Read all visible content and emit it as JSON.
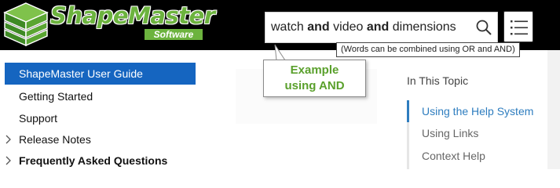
{
  "header": {
    "logo": {
      "title": "ShapeMaster",
      "subtitle": "Software"
    },
    "search": {
      "value_parts": [
        {
          "text": "watch ",
          "bold": false
        },
        {
          "text": "and",
          "bold": true
        },
        {
          "text": " video ",
          "bold": false
        },
        {
          "text": "and",
          "bold": true
        },
        {
          "text": " dimensions",
          "bold": false
        }
      ]
    }
  },
  "tooltip": {
    "text": "(Words can be combined using OR and AND)"
  },
  "callout": {
    "line1": "Example",
    "line2": "using AND"
  },
  "sidebar": {
    "items": [
      {
        "label": "ShapeMaster User Guide",
        "active": true,
        "expandable": false,
        "bold": false
      },
      {
        "label": "Getting Started",
        "active": false,
        "expandable": false,
        "bold": false
      },
      {
        "label": "Support",
        "active": false,
        "expandable": false,
        "bold": false
      },
      {
        "label": "Release Notes",
        "active": false,
        "expandable": true,
        "bold": false
      },
      {
        "label": "Frequently Asked Questions",
        "active": false,
        "expandable": true,
        "bold": true
      }
    ]
  },
  "topic": {
    "heading": "In This Topic",
    "links": [
      {
        "label": "Using the Help System",
        "active": true
      },
      {
        "label": "Using Links",
        "active": false
      },
      {
        "label": "Context Help",
        "active": false
      }
    ]
  },
  "colors": {
    "brand_green": "#6cb33e",
    "nav_active": "#1565c0",
    "link_active": "#2e7dbf"
  }
}
